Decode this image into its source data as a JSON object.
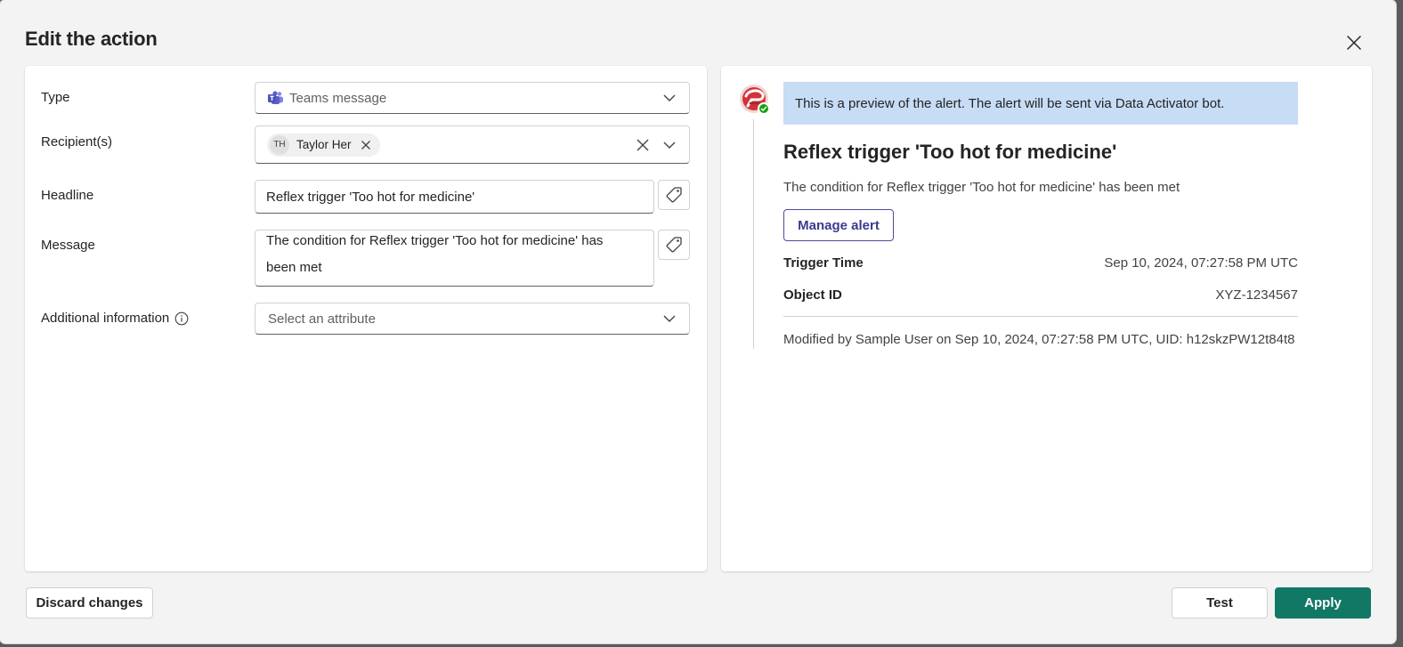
{
  "dialog": {
    "title": "Edit the action"
  },
  "form": {
    "type": {
      "label": "Type",
      "value": "Teams message"
    },
    "recipients": {
      "label": "Recipient(s)",
      "chips": [
        {
          "initials": "TH",
          "name": "Taylor Her"
        }
      ]
    },
    "headline": {
      "label": "Headline",
      "value": "Reflex trigger 'Too hot for medicine'"
    },
    "message": {
      "label": "Message",
      "value": "The condition for Reflex trigger 'Too hot for medicine' has been met"
    },
    "additional_info": {
      "label": "Additional information",
      "placeholder": "Select an attribute"
    }
  },
  "preview": {
    "banner": "This is a preview of the alert. The alert will be sent via Data Activator bot.",
    "title": "Reflex trigger 'Too hot for medicine'",
    "message": "The condition for Reflex trigger 'Too hot for medicine' has been met",
    "manage_label": "Manage alert",
    "fields": [
      {
        "key": "Trigger Time",
        "value": "Sep 10, 2024, 07:27:58 PM UTC"
      },
      {
        "key": "Object ID",
        "value": "XYZ-1234567"
      }
    ],
    "footer": "Modified by Sample User on Sep 10, 2024, 07:27:58 PM UTC, UID: h12skzPW12t84t8"
  },
  "buttons": {
    "discard": "Discard changes",
    "test": "Test",
    "apply": "Apply"
  },
  "colors": {
    "primary": "#117865",
    "banner": "#c7dcf5",
    "manage": "#4f4a9e",
    "teams": "#5b5fc7",
    "bot": "#d13438",
    "status": "#13a10e"
  },
  "icons": [
    "close-icon",
    "teams-icon",
    "chevron-down-icon",
    "dismiss-icon",
    "tag-icon",
    "info-icon",
    "bot-avatar-icon",
    "checkmark-icon"
  ]
}
